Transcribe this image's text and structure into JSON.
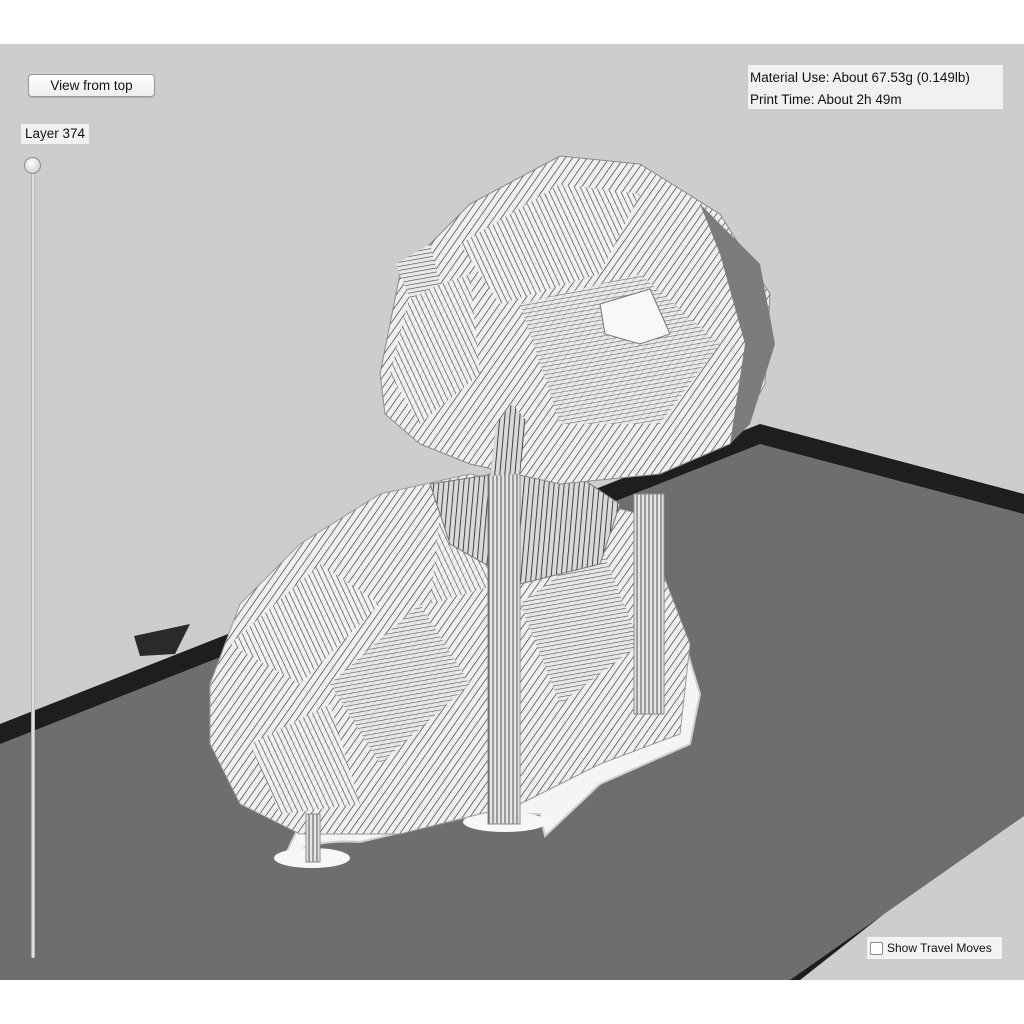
{
  "toolbar": {
    "view_from_top_label": "View from top"
  },
  "layer_slider": {
    "label": "Layer 374"
  },
  "print_info": {
    "material_use": "Material Use: About 67.53g (0.149lb)",
    "print_time": "Print Time: About 2h 49m"
  },
  "options": {
    "show_travel_moves_label": "Show Travel Moves",
    "show_travel_moves_checked": false
  },
  "colors": {
    "viewport_background": "#cdcdcd",
    "build_plate": "#6e6e6e",
    "plate_edge": "#1e1e1e",
    "model_fill": "#e6e6e6"
  }
}
